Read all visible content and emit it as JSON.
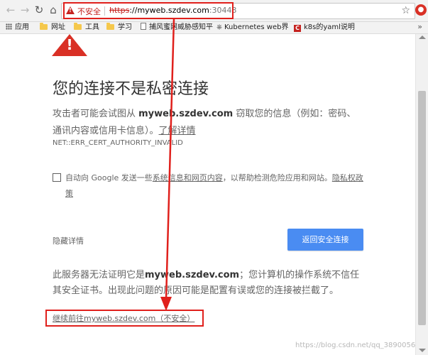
{
  "toolbar": {
    "back_icon": "back-arrow-icon",
    "forward_icon": "forward-arrow-icon",
    "reload_icon": "reload-icon",
    "home_icon": "home-icon",
    "security_label": "不安全",
    "url_scheme": "https",
    "url_sep": "://",
    "url_host": "myweb.szdev.com",
    "url_port": ":30443",
    "bookmark_star_icon": "star-icon",
    "extension_icon": "extension-icon"
  },
  "bookmarks": {
    "items": [
      {
        "label": "应用",
        "icon": "apps-grid-icon"
      },
      {
        "label": "网址",
        "icon": "folder-icon"
      },
      {
        "label": "工具",
        "icon": "folder-icon"
      },
      {
        "label": "学习",
        "icon": "folder-icon"
      },
      {
        "label": "捕风蜜网威胁感知平",
        "icon": "page-icon"
      },
      {
        "label": "Kubernetes web界",
        "icon": "kubernetes-icon"
      },
      {
        "label": "k8s的yaml说明",
        "icon": "csdn-c-icon"
      }
    ],
    "more": "»"
  },
  "interstitial": {
    "heading": "您的连接不是私密连接",
    "desc_prefix": "攻击者可能会试图从 ",
    "desc_host": "myweb.szdev.com",
    "desc_suffix": " 窃取您的信息（例如：密码、通讯内容或信用卡信息）。",
    "learn_more": "了解详情",
    "error_code": "NET::ERR_CERT_AUTHORITY_INVALID",
    "optin_prefix": "自动向 Google 发送一些",
    "optin_link": "系统信息和网页内容",
    "optin_middle": "，以帮助检测危险应用和网站。",
    "optin_privacy": "隐私权政策",
    "details_button": "隐藏详情",
    "back_button": "返回安全连接",
    "detail_prefix": "此服务器无法证明它是",
    "detail_host": "myweb.szdev.com",
    "detail_suffix": "；您计算机的操作系统不信任其安全证书。出现此问题的原因可能是配置有误或您的连接被拦截了。",
    "proceed_link": "继续前往myweb.szdev.com（不安全）"
  },
  "watermark": "https://blog.csdn.net/qq_3890056",
  "colors": {
    "danger": "#d93025",
    "primary_button": "#4a8cf2",
    "annotation": "#e0201c"
  }
}
